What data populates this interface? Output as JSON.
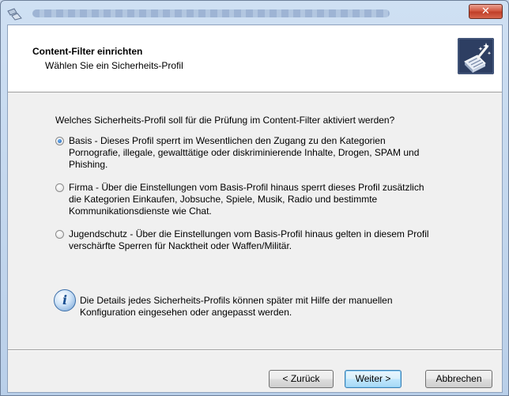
{
  "window": {
    "close_label": "✕"
  },
  "header": {
    "title": "Content-Filter einrichten",
    "subtitle": "Wählen Sie ein Sicherheits-Profil"
  },
  "main": {
    "question": "Welches Sicherheits-Profil soll für die Prüfung im Content-Filter aktiviert werden?",
    "options": [
      {
        "selected": true,
        "lines": [
          "Basis - Dieses Profil sperrt im Wesentlichen den Zugang zu den Kategorien",
          "Pornografie, illegale, gewalttätige oder diskriminierende Inhalte, Drogen, SPAM und",
          "Phishing."
        ]
      },
      {
        "selected": false,
        "lines": [
          "Firma - Über die Einstellungen vom Basis-Profil hinaus sperrt dieses Profil zusätzlich",
          "die Kategorien Einkaufen, Jobsuche, Spiele, Musik, Radio und bestimmte",
          "Kommunikationsdienste wie Chat."
        ]
      },
      {
        "selected": false,
        "lines": [
          "Jugendschutz - Über die Einstellungen vom Basis-Profil hinaus gelten in diesem Profil",
          "verschärfte Sperren für Nacktheit oder Waffen/Militär."
        ]
      }
    ],
    "info": {
      "icon": "info-icon",
      "lines": [
        "Die Details jedes Sicherheits-Profils können später mit Hilfe der manuellen",
        "Konfiguration eingesehen oder angepasst werden."
      ]
    }
  },
  "buttons": {
    "back": "< Zurück",
    "next": "Weiter >",
    "cancel": "Abbrechen"
  }
}
